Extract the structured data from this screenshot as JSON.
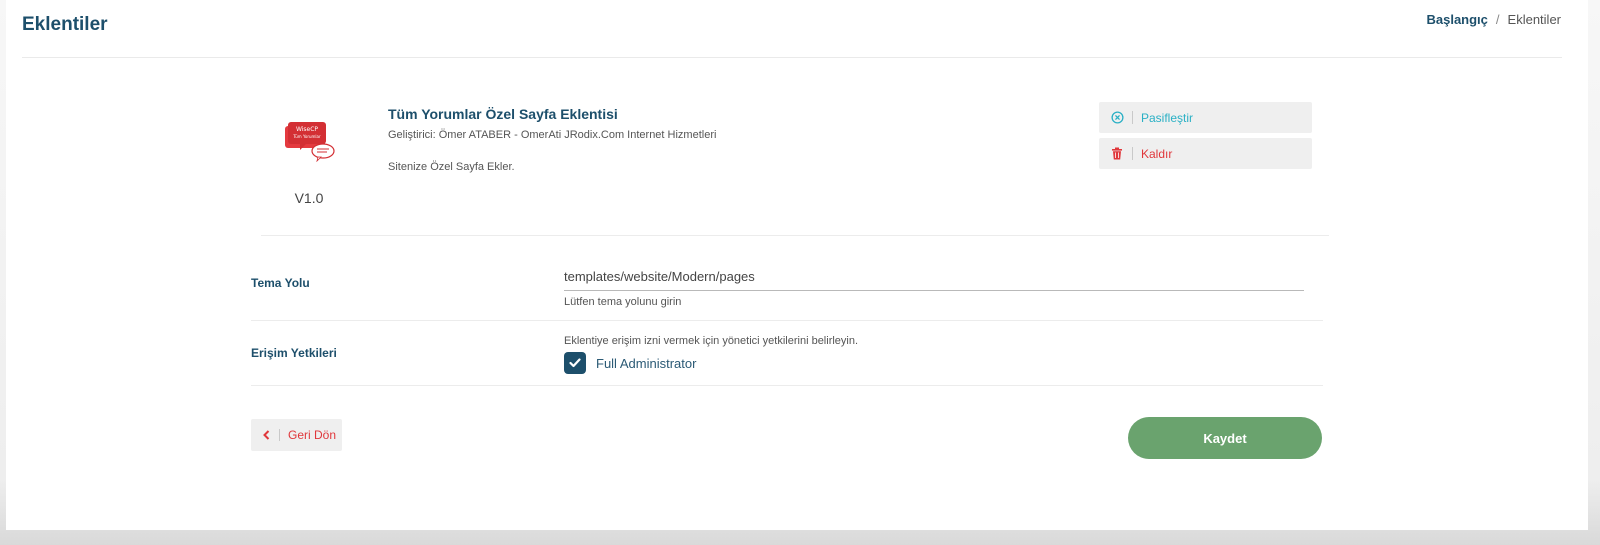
{
  "page": {
    "title": "Eklentiler"
  },
  "breadcrumb": {
    "home": "Başlangıç",
    "separator": "/",
    "current": "Eklentiler"
  },
  "plugin": {
    "logo_text_line1": "WiseCP",
    "logo_text_line2": "Tüm Yorumlar",
    "version": "V1.0",
    "name": "Tüm Yorumlar Özel Sayfa Eklentisi",
    "developer": "Geliştirici: Ömer ATABER - OmerAti JRodix.Com Internet Hizmetleri",
    "description": "Sitenize Özel Sayfa Ekler."
  },
  "actions": {
    "deactivate_label": "Pasifleştir",
    "remove_label": "Kaldır"
  },
  "form": {
    "theme_path": {
      "label": "Tema Yolu",
      "value": "templates/website/Modern/pages",
      "help": "Lütfen tema yolunu girin"
    },
    "permissions": {
      "label": "Erişim Yetkileri",
      "help": "Eklentiye erişim izni vermek için yönetici yetkilerini belirleyin.",
      "options": [
        {
          "label": "Full Administrator",
          "checked": true
        }
      ]
    }
  },
  "footer": {
    "back_label": "Geri Dön",
    "save_label": "Kaydet"
  },
  "colors": {
    "title": "#1d4f6b",
    "deactivate": "#2ab0c5",
    "remove": "#e0373b",
    "save": "#6aa36e",
    "checkbox": "#1d4f6b"
  }
}
